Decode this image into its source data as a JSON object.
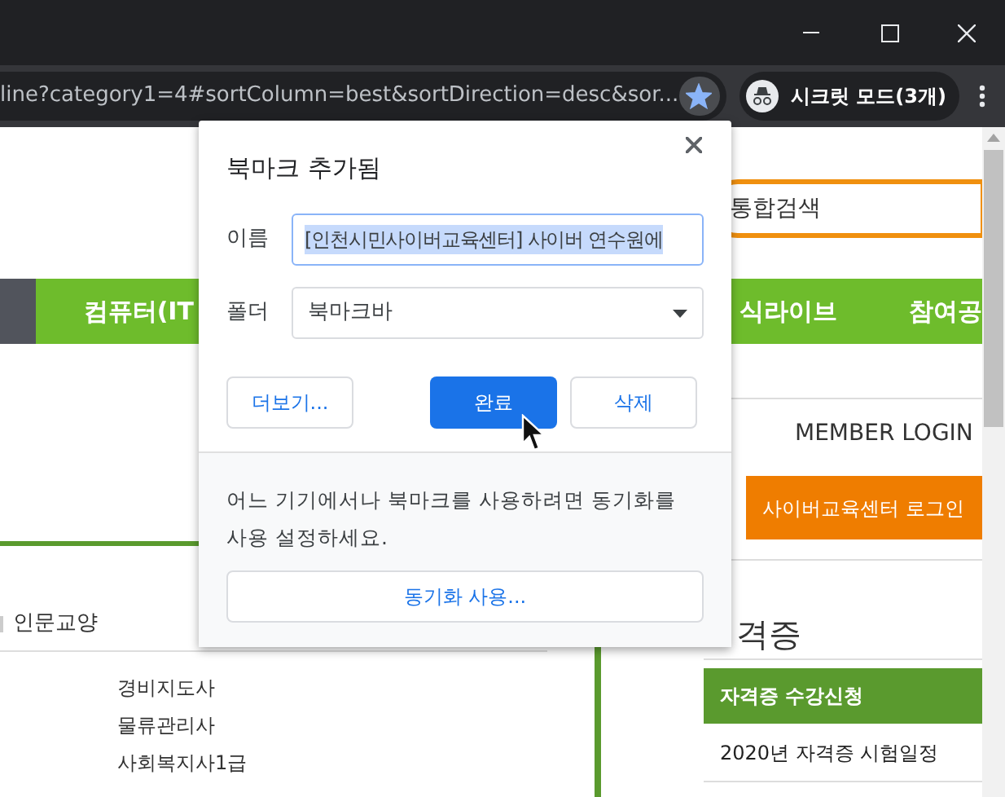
{
  "toolbar": {
    "url": "line?category1=4#sortColumn=best&sortDirection=desc&sor...",
    "bookmarked": true,
    "profile_label": "시크릿 모드(3개)"
  },
  "page": {
    "search_placeholder": "통합검색",
    "nav": [
      "컴퓨터(IT",
      "식라이브",
      "참여공"
    ],
    "member_login": "MEMBER LOGIN",
    "login_button": "사이버교육센터 로그인",
    "category": "인문교양",
    "courses": [
      "경비지도사",
      "물류관리사",
      "사회복지사1급"
    ],
    "heading": "격증",
    "side_links": [
      {
        "label": "자격증 수강신청",
        "selected": true
      },
      {
        "label": "2020년 자격증 시험일정",
        "selected": false
      }
    ]
  },
  "dialog": {
    "title": "북마크 추가됨",
    "name_label": "이름",
    "name_value": "[인천시민사이버교육센터] 사이버 연수원에",
    "name_text_selected": true,
    "folder_label": "폴더",
    "folder_value": "북마크바",
    "buttons": [
      {
        "label": "더보기...",
        "kind": "secondary"
      },
      {
        "label": "완료",
        "kind": "primary"
      },
      {
        "label": "삭제",
        "kind": "secondary"
      }
    ],
    "sync_message": "어느 기기에서나 북마크를 사용하려면 동기화를 사용 설정하세요.",
    "sync_button": "동기화 사용..."
  }
}
